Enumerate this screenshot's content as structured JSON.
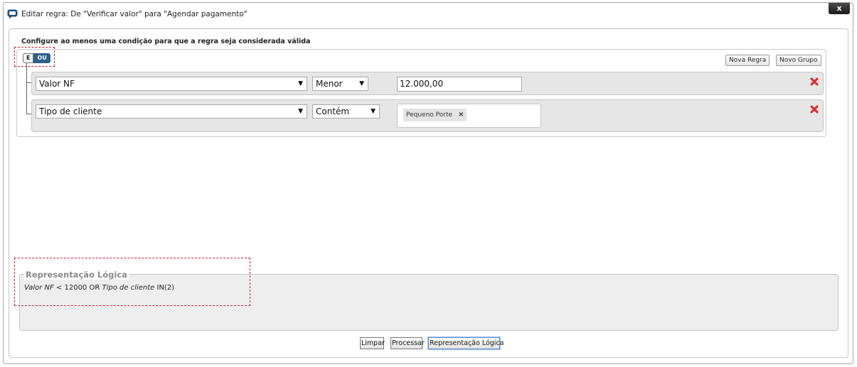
{
  "dialog": {
    "title": "Editar regra: De \"Verificar valor\" para \"Agendar pagamento\"",
    "close_label": "x",
    "icon": "chat-bubble-icon"
  },
  "builder": {
    "instruction": "Configure ao menos uma condição para que a regra seja considerada válida",
    "conjunctions": {
      "and_label": "E",
      "or_label": "OU",
      "selected": "OU"
    },
    "new_rule_label": "Nova Regra",
    "new_group_label": "Novo Grupo",
    "rules": [
      {
        "field": "Valor NF",
        "operator": "Menor",
        "value": "12.000,00"
      },
      {
        "field": "Tipo de cliente",
        "operator": "Contém",
        "tags": [
          "Pequeno Porte"
        ],
        "tag_remove": "×"
      }
    ],
    "delete_icon": "red-x-delete-icon",
    "select_arrow": "▼"
  },
  "logic": {
    "legend": "Representação Lógica",
    "expression": {
      "part1_field": "Valor NF",
      "part1_op": " < 12000 OR ",
      "part2_field": "Tipo de cliente",
      "part2_op": " IN(2)"
    }
  },
  "footer": {
    "clear_label": "Limpar",
    "process_label": "Processar",
    "logic_label": "Representação Lógica"
  },
  "colors": {
    "or_button": "#2c5f8a",
    "highlight": "#d12027",
    "row_background": "#e6e6e6",
    "delete": "#e0262b"
  }
}
